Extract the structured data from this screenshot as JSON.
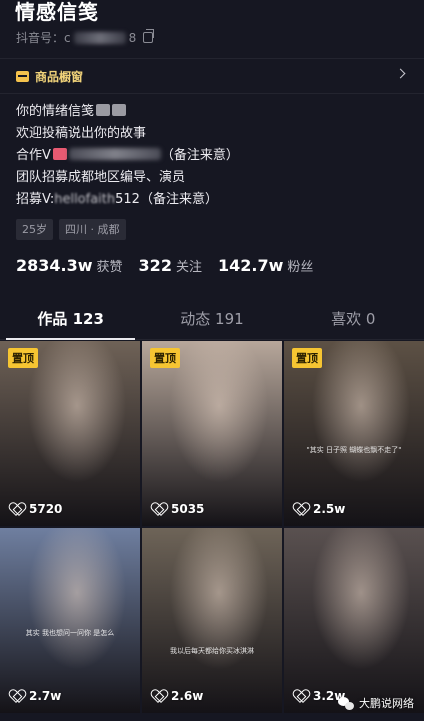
{
  "profile": {
    "name": "情感信笺",
    "douyin_id_prefix": "抖音号：c",
    "douyin_id_suffix": "8"
  },
  "shop": {
    "label": "商品橱窗"
  },
  "bio": {
    "line1": "你的情绪信笺",
    "line2": "欢迎投稿说出你的故事",
    "line3_prefix": "合作V",
    "line3_suffix": "（备注来意）",
    "line4": "团队招募成都地区编导、演员",
    "line5_prefix": "招募V:",
    "line5_visible": "hellofaith",
    "line5_suffix": "512（备注来意）"
  },
  "tags": [
    "25岁",
    "四川 · 成都"
  ],
  "stats": [
    {
      "value": "2834.3w",
      "label": "获赞"
    },
    {
      "value": "322",
      "label": "关注"
    },
    {
      "value": "142.7w",
      "label": "粉丝"
    }
  ],
  "tabs": [
    {
      "label": "作品 123",
      "active": true
    },
    {
      "label": "动态 191",
      "active": false
    },
    {
      "label": "喜欢 0",
      "active": false
    }
  ],
  "videos": [
    {
      "pinned": true,
      "pin_label": "置顶",
      "likes": "5720",
      "bg": "#6f6257",
      "subtitle": ""
    },
    {
      "pinned": true,
      "pin_label": "置顶",
      "likes": "5035",
      "bg": "#b7a79b",
      "subtitle": ""
    },
    {
      "pinned": true,
      "pin_label": "置顶",
      "likes": "2.5w",
      "bg": "#5d5145",
      "subtitle": "\"其实 日子照 蝴蝶也飘不走了\""
    },
    {
      "pinned": false,
      "pin_label": "",
      "likes": "2.7w",
      "bg": "#6f7fa0",
      "subtitle": "其实 我也想问一问你 是怎么"
    },
    {
      "pinned": false,
      "pin_label": "",
      "likes": "2.6w",
      "bg": "#6e6458",
      "subtitle": "我以后每天都给你买冰淇淋"
    },
    {
      "pinned": false,
      "pin_label": "",
      "likes": "3.2w",
      "bg": "#5a5150",
      "subtitle": ""
    }
  ],
  "watermark": {
    "text": "大鹏说网络"
  }
}
